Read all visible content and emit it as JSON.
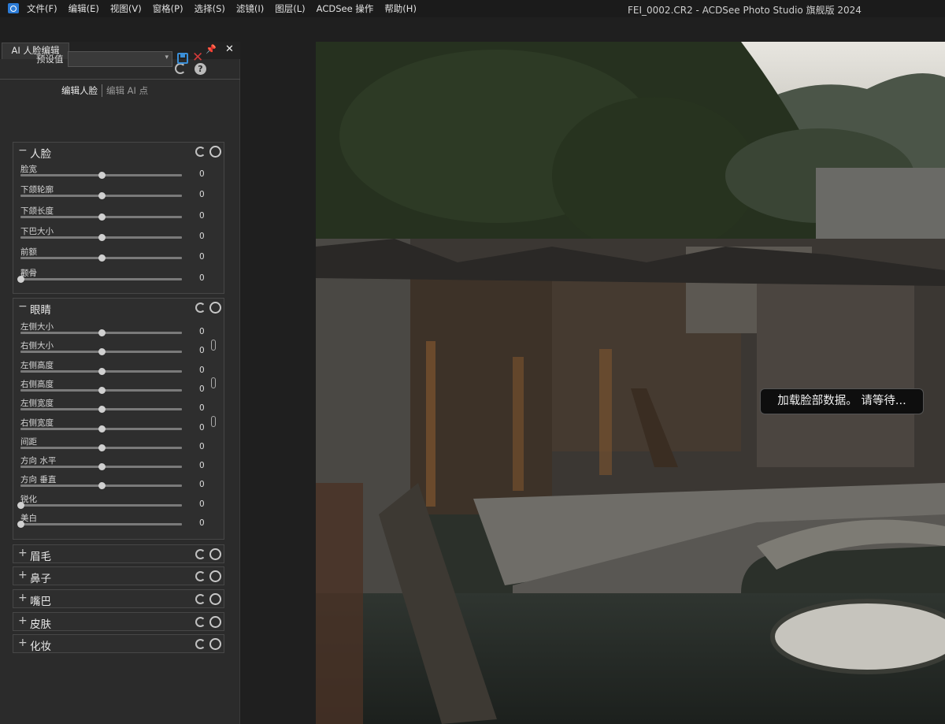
{
  "window": {
    "title": "FEI_0002.CR2 - ACDSee Photo Studio 旗舰版 2024",
    "menu": [
      "文件(F)",
      "编辑(E)",
      "视图(V)",
      "窗格(P)",
      "选择(S)",
      "滤镜(I)",
      "图层(L)",
      "ACDSee 操作",
      "帮助(H)"
    ]
  },
  "panel": {
    "tab_label": "AI 人脸编辑",
    "pin_glyph": "📌",
    "close_glyph": "✕",
    "help_glyph": "?",
    "preset_label": "预设值",
    "preset_value": "",
    "subtabs": {
      "active": "编辑人脸",
      "other": "编辑 AI 点"
    },
    "groups": [
      {
        "title": "人脸",
        "sign": "−",
        "expanded": true,
        "sliders": [
          {
            "label": "脸宽",
            "value": "0",
            "level": 0.5
          },
          {
            "label": "下颌轮廓",
            "value": "0",
            "level": 0.5
          },
          {
            "label": "下颌长度",
            "value": "0",
            "level": 0.5
          },
          {
            "label": "下巴大小",
            "value": "0",
            "level": 0.5
          },
          {
            "label": "前额",
            "value": "0",
            "level": 0.5
          },
          {
            "label": "颧骨",
            "value": "0",
            "level": 0.0
          }
        ]
      },
      {
        "title": "眼睛",
        "sign": "−",
        "expanded": true,
        "sliders": [
          {
            "label": "左侧大小",
            "value": "0",
            "level": 0.5
          },
          {
            "label": "右侧大小",
            "value": "0",
            "level": 0.5
          },
          {
            "label": "左侧高度",
            "value": "0",
            "level": 0.5
          },
          {
            "label": "右侧高度",
            "value": "0",
            "level": 0.5
          },
          {
            "label": "左侧宽度",
            "value": "0",
            "level": 0.5
          },
          {
            "label": "右侧宽度",
            "value": "0",
            "level": 0.5
          },
          {
            "label": "间距",
            "value": "0",
            "level": 0.5
          },
          {
            "label": "方向 水平",
            "value": "0",
            "level": 0.5
          },
          {
            "label": "方向 垂直",
            "value": "0",
            "level": 0.5
          },
          {
            "label": "锐化",
            "value": "0",
            "level": 0.0
          },
          {
            "label": "美白",
            "value": "0",
            "level": 0.0
          }
        ]
      },
      {
        "title": "眉毛",
        "sign": "+",
        "expanded": false
      },
      {
        "title": "鼻子",
        "sign": "+",
        "expanded": false
      },
      {
        "title": "嘴巴",
        "sign": "+",
        "expanded": false
      },
      {
        "title": "皮肤",
        "sign": "+",
        "expanded": false
      },
      {
        "title": "化妆",
        "sign": "+",
        "expanded": false
      }
    ]
  },
  "viewer": {
    "status_toast": "加载脸部数据。 请等待..."
  },
  "colors": {
    "accent": "#3a8fd8",
    "delete": "#d23a3a"
  }
}
